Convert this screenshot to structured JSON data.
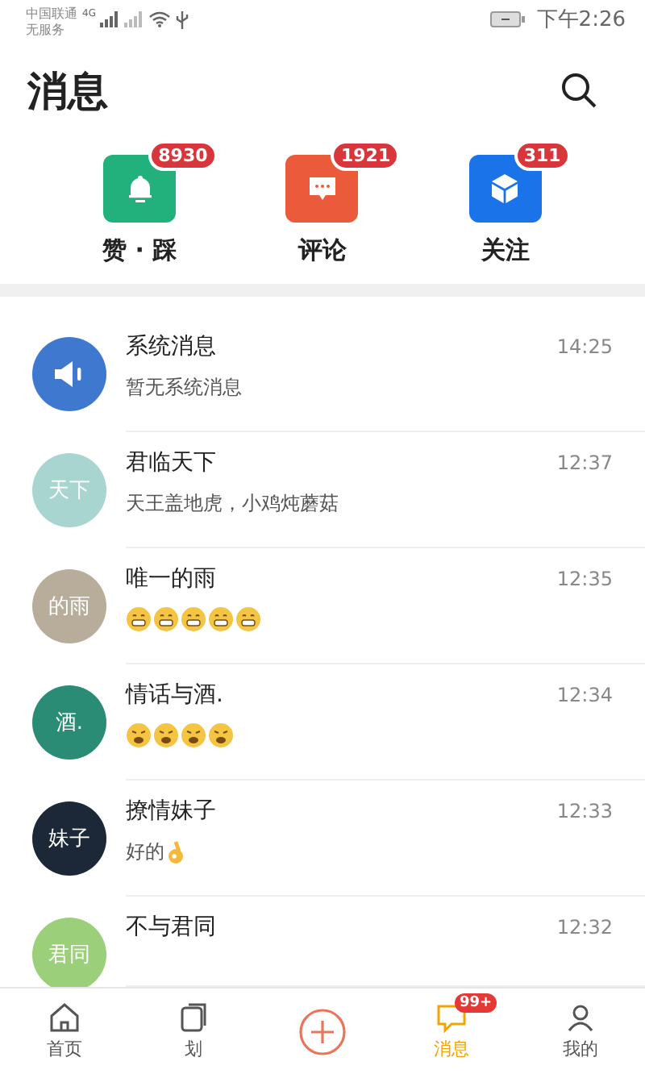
{
  "status_bar": {
    "carrier": "中国联通",
    "carrier_2": "无服务",
    "network": "4G",
    "time": "下午2:26"
  },
  "header": {
    "title": "消息"
  },
  "shortcuts": [
    {
      "kind": "bell",
      "label": "赞 · 踩",
      "badge": "8930",
      "color": "#22b07d"
    },
    {
      "kind": "comment",
      "label": "评论",
      "badge": "1921",
      "color": "#ec5a3c"
    },
    {
      "kind": "cube",
      "label": "关注",
      "badge": "311",
      "color": "#1a73e8"
    }
  ],
  "messages": [
    {
      "name": "系统消息",
      "time": "14:25",
      "avatar": {
        "kind": "system",
        "color": "#3f78cf"
      },
      "preview": {
        "text": "暂无系统消息"
      }
    },
    {
      "name": "君临天下",
      "time": "12:37",
      "avatar": {
        "kind": "text",
        "text": "天下",
        "color": "#a8d5cf"
      },
      "preview": {
        "text": "天王盖地虎，小鸡炖蘑菇"
      }
    },
    {
      "name": "唯一的雨",
      "time": "12:35",
      "avatar": {
        "kind": "text",
        "text": "的雨",
        "color": "#b8ad9a"
      },
      "preview": {
        "emojis": [
          {
            "kind": "grin"
          },
          {
            "kind": "grin"
          },
          {
            "kind": "grin"
          },
          {
            "kind": "grin"
          },
          {
            "kind": "grin"
          }
        ]
      }
    },
    {
      "name": "情话与酒.",
      "time": "12:34",
      "avatar": {
        "kind": "text",
        "text": "酒.",
        "color": "#2a8c74"
      },
      "preview": {
        "emojis": [
          {
            "kind": "weary"
          },
          {
            "kind": "weary"
          },
          {
            "kind": "weary"
          },
          {
            "kind": "weary"
          }
        ]
      }
    },
    {
      "name": "撩情妹子",
      "time": "12:33",
      "avatar": {
        "kind": "text",
        "text": "妹子",
        "color": "#1c2838"
      },
      "preview": {
        "text": "好的",
        "emojis": [
          {
            "kind": "ok-hand"
          }
        ]
      }
    },
    {
      "name": "不与君同",
      "time": "12:32",
      "avatar": {
        "kind": "text",
        "text": "君同",
        "color": "#9ccf7a"
      }
    }
  ],
  "tab_bar": [
    {
      "kind": "home",
      "label": "首页",
      "selected": false
    },
    {
      "kind": "swipe",
      "label": "划",
      "selected": false
    },
    {
      "kind": "plus",
      "selected": false
    },
    {
      "kind": "message",
      "label": "消息",
      "badge": "99+",
      "selected": true
    },
    {
      "kind": "profile",
      "label": "我的",
      "selected": false
    }
  ]
}
